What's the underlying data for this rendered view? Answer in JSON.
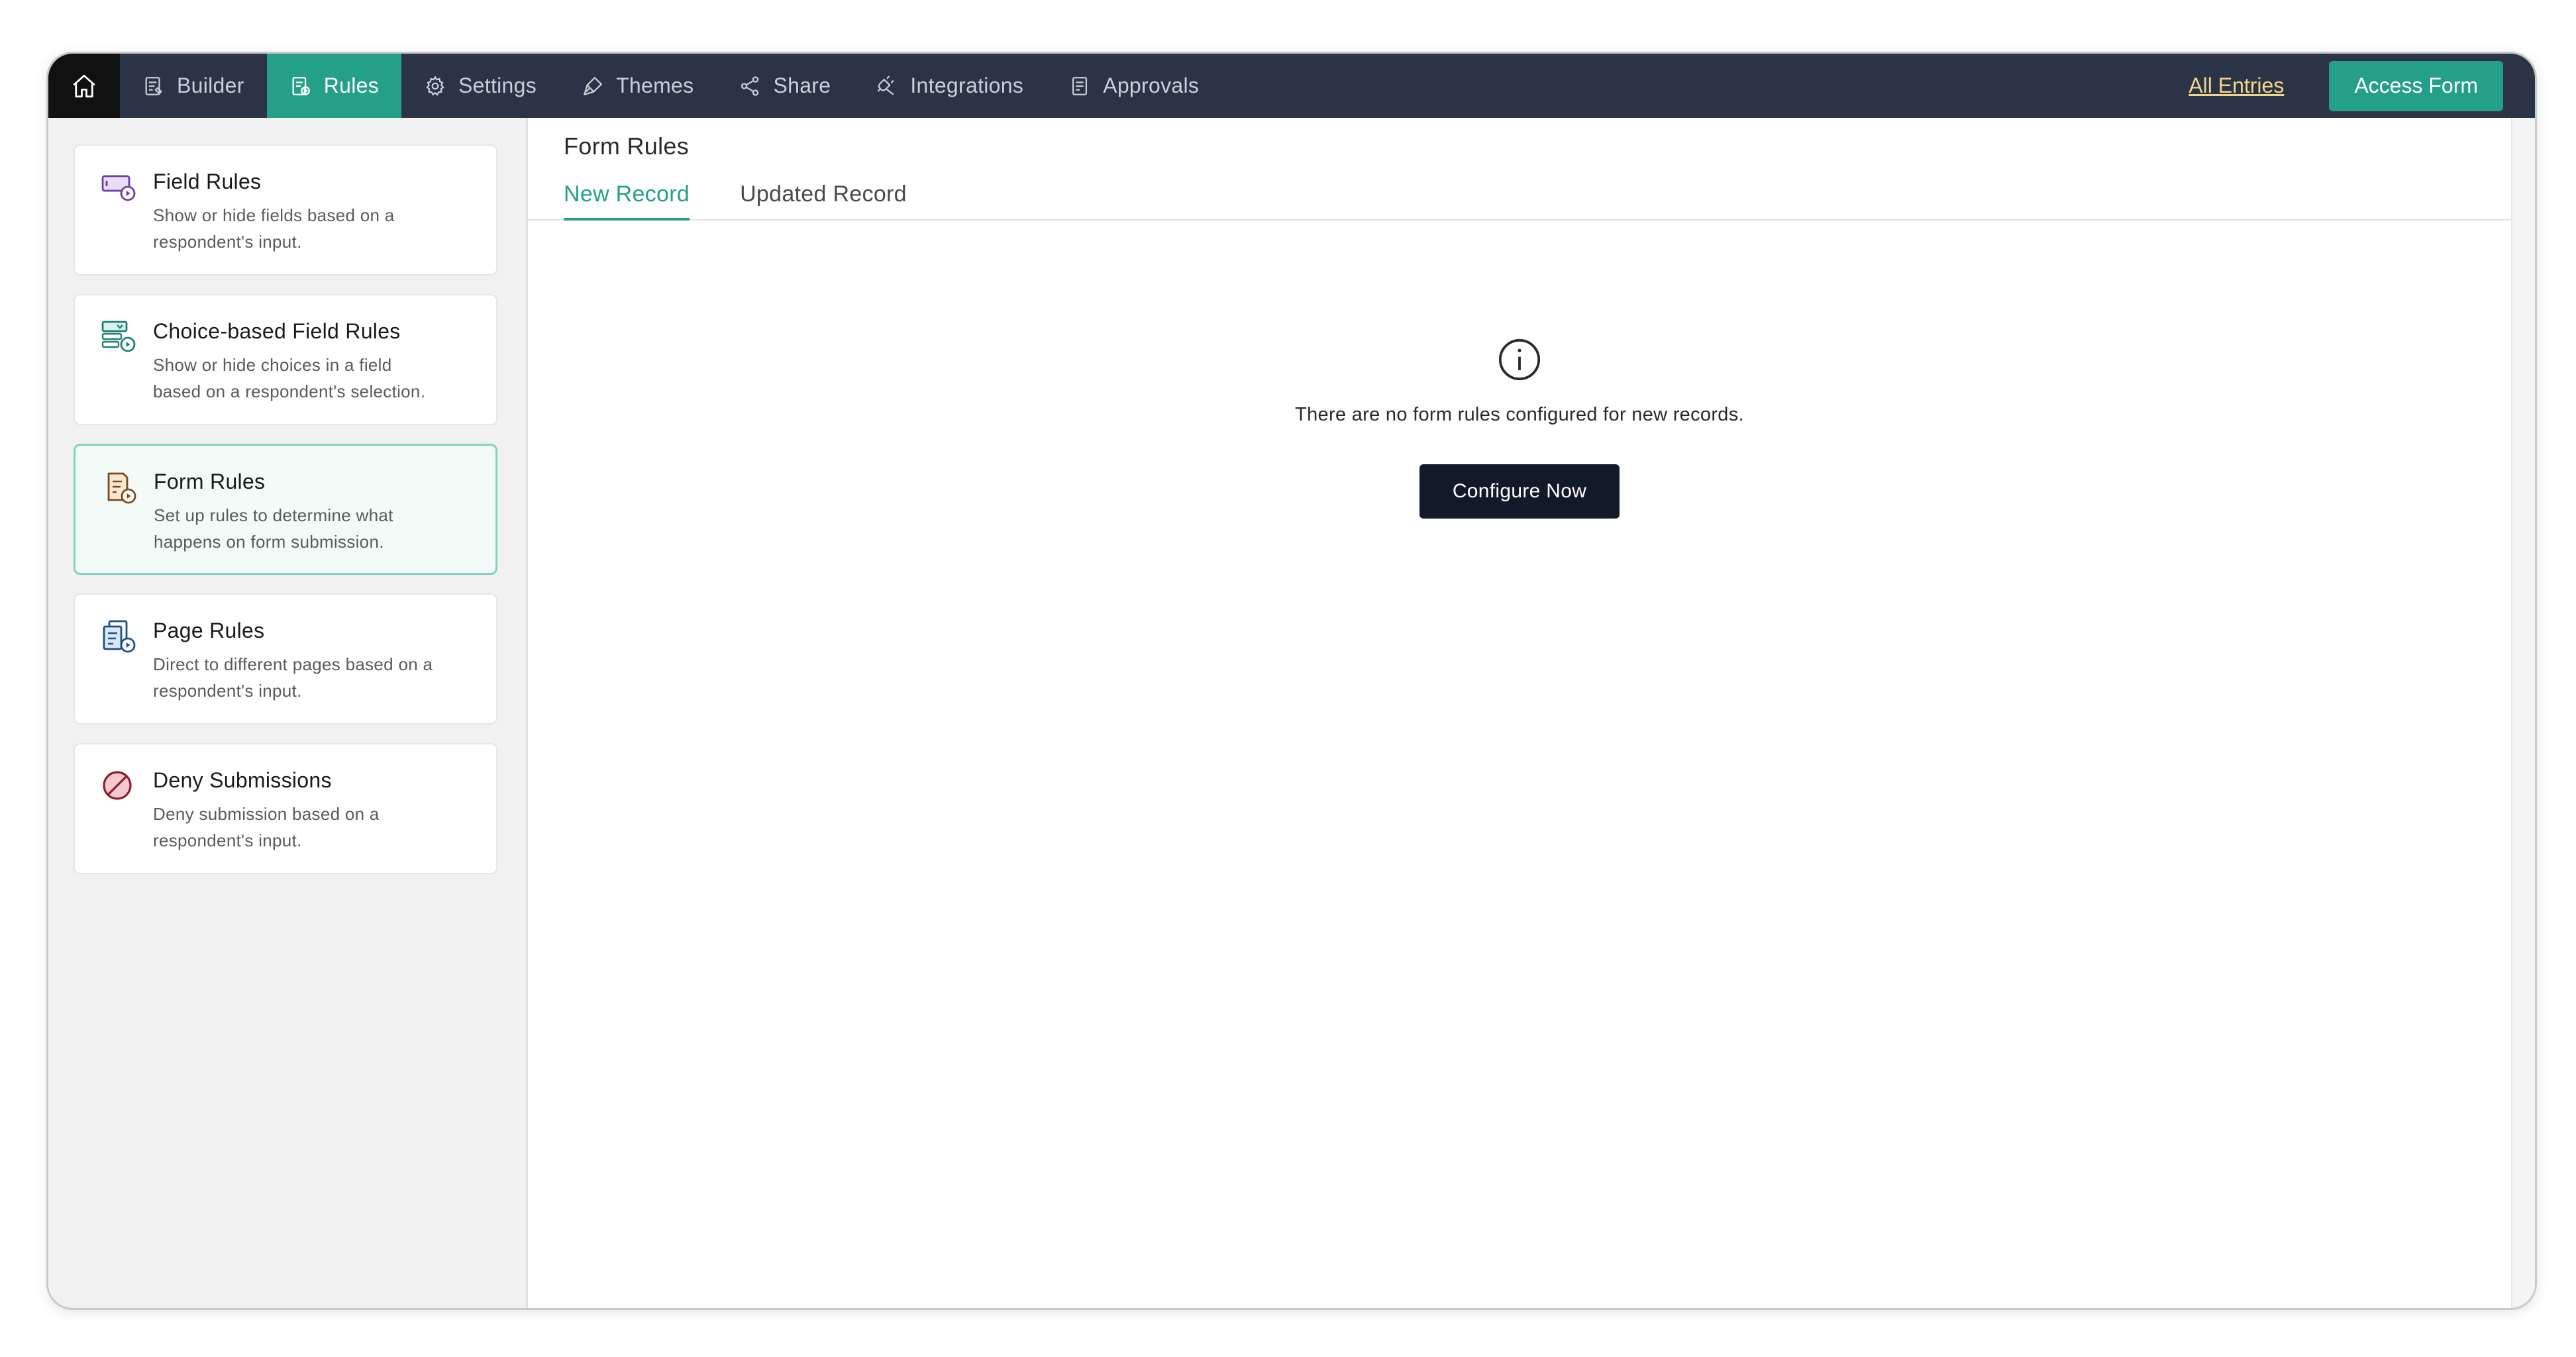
{
  "nav": {
    "items": [
      {
        "label": "Builder",
        "icon": "builder-icon",
        "active": false
      },
      {
        "label": "Rules",
        "icon": "rules-icon",
        "active": true
      },
      {
        "label": "Settings",
        "icon": "gear-icon",
        "active": false
      },
      {
        "label": "Themes",
        "icon": "brush-icon",
        "active": false
      },
      {
        "label": "Share",
        "icon": "share-icon",
        "active": false
      },
      {
        "label": "Integrations",
        "icon": "plug-icon",
        "active": false
      },
      {
        "label": "Approvals",
        "icon": "approvals-icon",
        "active": false
      }
    ],
    "all_entries": "All Entries",
    "access_form": "Access Form"
  },
  "sidebar": {
    "cards": [
      {
        "title": "Field Rules",
        "desc_line1": "Show or hide fields based on a",
        "desc_line2": "respondent's input.",
        "icon": "field-rules-icon"
      },
      {
        "title": "Choice-based Field Rules",
        "desc_line1": "Show or hide choices in a field",
        "desc_line2": "based on a respondent's selection.",
        "icon": "choice-rules-icon"
      },
      {
        "title": "Form Rules",
        "desc_line1": "Set up rules to determine what",
        "desc_line2": "happens on form submission.",
        "icon": "form-rules-icon",
        "active": true
      },
      {
        "title": "Page Rules",
        "desc_line1": "Direct to different pages based on a",
        "desc_line2": "respondent's input.",
        "icon": "page-rules-icon"
      },
      {
        "title": "Deny Submissions",
        "desc_line1": "Deny submission based on a",
        "desc_line2": "respondent's input.",
        "icon": "deny-icon"
      }
    ]
  },
  "main": {
    "title": "Form Rules",
    "tabs": [
      {
        "label": "New Record",
        "active": true
      },
      {
        "label": "Updated Record",
        "active": false
      }
    ],
    "empty_message": "There are no form rules configured for new records.",
    "configure_label": "Configure Now"
  },
  "colors": {
    "accent": "#24a088",
    "nav_bg": "#2b3447",
    "button_dark": "#121a2a",
    "link_yellow": "#f0d68a"
  }
}
